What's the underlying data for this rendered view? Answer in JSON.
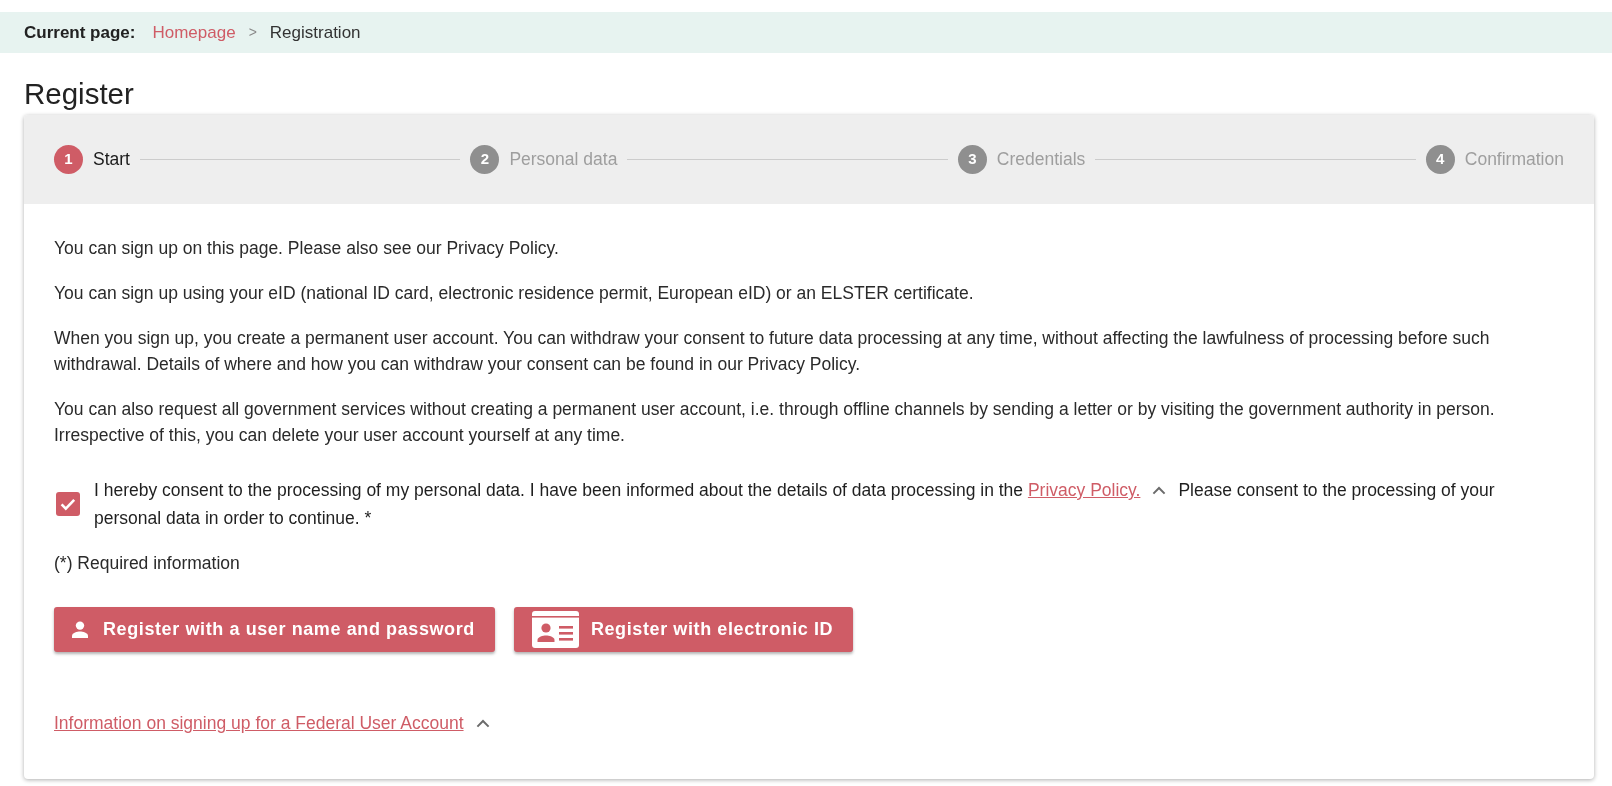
{
  "breadcrumb": {
    "label": "Current page:",
    "separator": ">",
    "items": [
      {
        "text": "Homepage",
        "kind": "link"
      },
      {
        "text": "Registration",
        "kind": "current"
      }
    ]
  },
  "title": "Register",
  "stepper": {
    "steps": [
      {
        "number": "1",
        "label": "Start",
        "selected": true
      },
      {
        "number": "2",
        "label": "Personal data",
        "selected": false
      },
      {
        "number": "3",
        "label": "Credentials",
        "selected": false
      },
      {
        "number": "4",
        "label": "Confirmation",
        "selected": false
      }
    ]
  },
  "intro_paragraphs": [
    "You can sign up on this page. Please also see our Privacy Policy.",
    "You can sign up using your eID (national ID card, electronic residence permit, European eID) or an ELSTER certificate.",
    "When you sign up, you create a permanent user account. You can withdraw your consent to future data processing at any time, without affecting the lawfulness of processing before such withdrawal. Details of where and how you can withdraw your consent can be found in our Privacy Policy.",
    "You can also request all government services without creating a permanent user account, i.e. through offline channels by sending a letter or by visiting the government authority in person. Irrespective of this, you can delete your user account yourself at any time."
  ],
  "consent": {
    "checked": true,
    "text": "I hereby consent to the processing of my personal data. I have been informed about the details of data processing in the",
    "link": "Privacy Policy.",
    "message": "Please consent to the processing of your personal data in order to continue. *"
  },
  "required_note": "(*) Required information",
  "buttons": [
    {
      "label": "Register with a user name and password",
      "kind": "user"
    },
    {
      "label": "Register with electronic ID",
      "kind": "eid"
    }
  ],
  "info_link": "Information on signing up for a Federal User Account"
}
